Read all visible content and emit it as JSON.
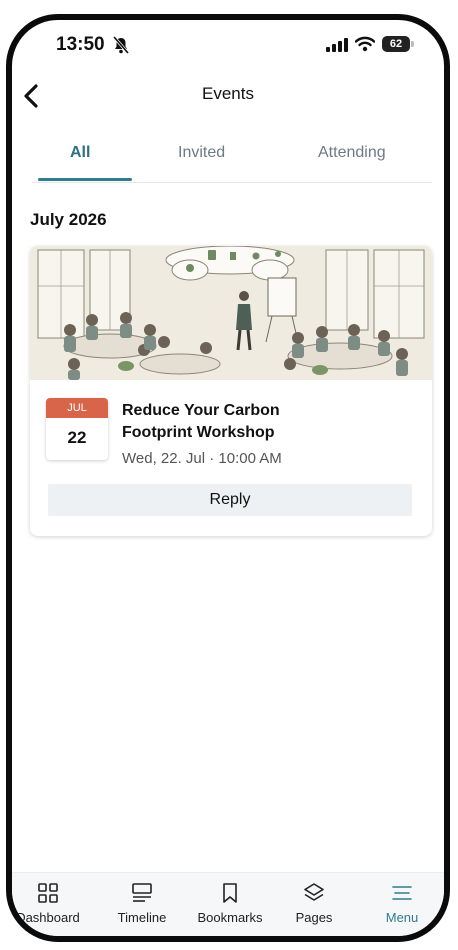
{
  "status_bar": {
    "time": "13:50",
    "battery": "62"
  },
  "nav": {
    "title": "Events"
  },
  "tabs": [
    {
      "label": "All",
      "active": true
    },
    {
      "label": "Invited",
      "active": false
    },
    {
      "label": "Attending",
      "active": false
    }
  ],
  "section": {
    "month_heading": "July 2026"
  },
  "event": {
    "date_month": "JUL",
    "date_day": "22",
    "title": "Reduce Your Carbon Footprint Workshop",
    "datetime": "Wed, 22. Jul · 10:00 AM",
    "reply_label": "Reply"
  },
  "bottom_nav": [
    {
      "label": "Dashboard",
      "icon": "dashboard-icon"
    },
    {
      "label": "Timeline",
      "icon": "timeline-icon"
    },
    {
      "label": "Bookmarks",
      "icon": "bookmark-icon"
    },
    {
      "label": "Pages",
      "icon": "layers-icon"
    },
    {
      "label": "Menu",
      "icon": "menu-icon",
      "active": true
    }
  ],
  "colors": {
    "accent": "#2f7c8e",
    "date_badge": "#d8654a"
  }
}
